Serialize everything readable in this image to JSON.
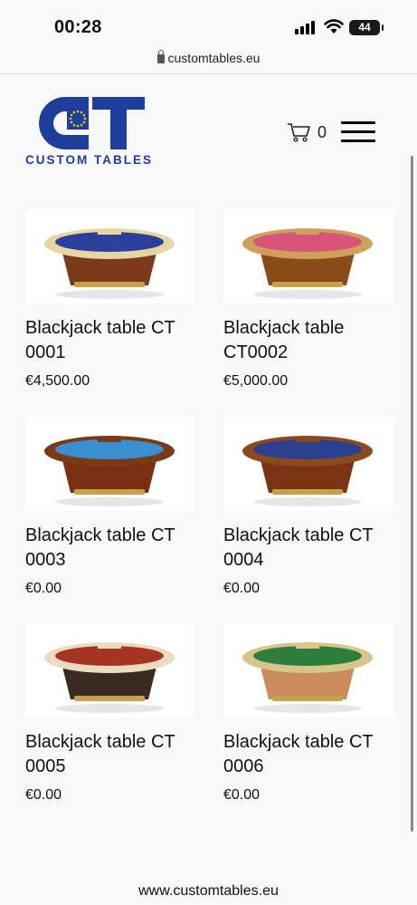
{
  "status_bar": {
    "time": "00:28",
    "battery": "44"
  },
  "browser": {
    "url": "customtables.eu"
  },
  "header": {
    "logo_text": "CUSTOM TABLES",
    "logo_colors": {
      "blue": "#1d3f9b",
      "eu_star": "#f3c400"
    },
    "cart_count": "0"
  },
  "products": [
    {
      "title": "Blackjack table CT 0001",
      "price": "€4,500.00",
      "felt": "#2c3f9a",
      "rim": "#e7d6a2",
      "base": "#7a3a18"
    },
    {
      "title": "Blackjack table CT0002",
      "price": "€5,000.00",
      "felt": "#d8547a",
      "rim": "#cfa05a",
      "base": "#8a4a1a"
    },
    {
      "title": "Blackjack table CT 0003",
      "price": "€0.00",
      "felt": "#3a8fd1",
      "rim": "#7a3a16",
      "base": "#7a2e12"
    },
    {
      "title": "Blackjack table CT 0004",
      "price": "€0.00",
      "felt": "#2b3f8f",
      "rim": "#8a4a1e",
      "base": "#7a3414"
    },
    {
      "title": "Blackjack table CT 0005",
      "price": "€0.00",
      "felt": "#a83524",
      "rim": "#e9dcc0",
      "base": "#3a2a22"
    },
    {
      "title": "Blackjack table CT 0006",
      "price": "€0.00",
      "felt": "#2f7d3c",
      "rim": "#d8c58a",
      "base": "#c98a5e"
    }
  ],
  "footer": {
    "text": "www.customtables.eu"
  }
}
